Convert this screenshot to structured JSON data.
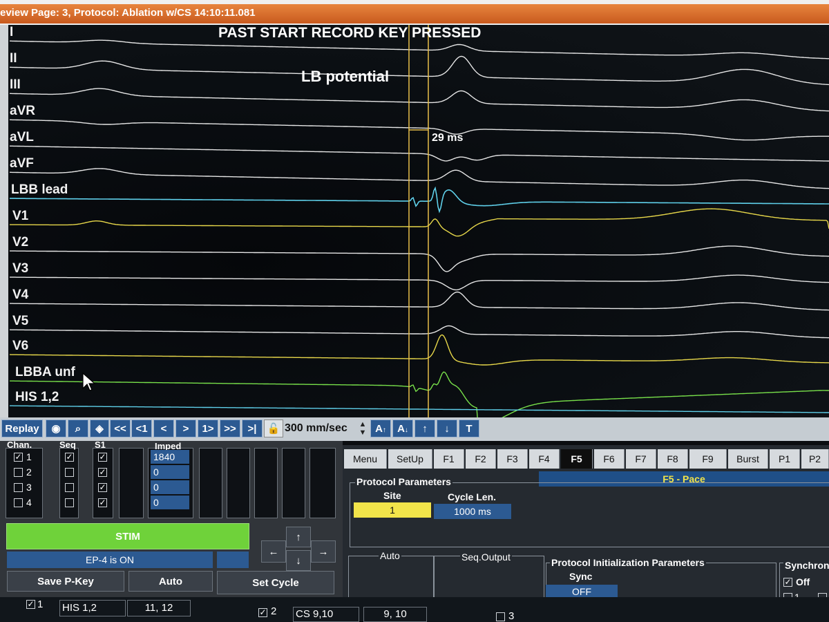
{
  "title": "eview Page: 3, Protocol: Ablation w/CS   14:10:11.081",
  "banners": {
    "main": "PAST START RECORD KEY PRESSED",
    "sub": "LB potential",
    "interval": "29 ms"
  },
  "leads": [
    {
      "label": "I",
      "color": "#e6e6e6"
    },
    {
      "label": "II",
      "color": "#e6e6e6"
    },
    {
      "label": "III",
      "color": "#e6e6e6"
    },
    {
      "label": "aVR",
      "color": "#e6e6e6"
    },
    {
      "label": "aVL",
      "color": "#e6e6e6"
    },
    {
      "label": "aVF",
      "color": "#e6e6e6"
    },
    {
      "label": "LBB lead",
      "color": "#5fd0ea"
    },
    {
      "label": "V1",
      "color": "#e8d84a"
    },
    {
      "label": "V2",
      "color": "#e6e6e6"
    },
    {
      "label": "V3",
      "color": "#e6e6e6"
    },
    {
      "label": "V4",
      "color": "#e6e6e6"
    },
    {
      "label": "V5",
      "color": "#e6e6e6"
    },
    {
      "label": "V6",
      "color": "#e8d84a"
    },
    {
      "label": "LBBA unf",
      "color": "#78e04a"
    },
    {
      "label": "HIS 1,2",
      "color": "#5fd0ea"
    }
  ],
  "toolbar": {
    "replay": "Replay",
    "first": "<<",
    "prev1": "<1",
    "prev": "<",
    "next": ">",
    "next1": "1>",
    "last": ">>",
    "end": ">|",
    "speed": "300 mm/sec",
    "amp_up": "A",
    "amp_down": "A",
    "up": "↑",
    "down": "↓",
    "t": "T"
  },
  "stim_panel": {
    "chan_header": "Chan.",
    "seq_header": "Seq",
    "s1_header": "S1",
    "imped_header": "Imped",
    "channels": [
      {
        "num": "1",
        "checked": true
      },
      {
        "num": "2",
        "checked": false
      },
      {
        "num": "3",
        "checked": false
      },
      {
        "num": "4",
        "checked": false
      }
    ],
    "seq_checked": [
      true,
      false,
      false,
      false
    ],
    "s1_checked": [
      true,
      true,
      true,
      true
    ],
    "imped_values": [
      "1840",
      "0",
      "0",
      "0"
    ],
    "stim_label": "STIM",
    "stim_color": "#6fd23a",
    "status": "EP-4 is ON",
    "save_pkey": "Save P-Key",
    "auto": "Auto",
    "set_cycle": "Set Cycle"
  },
  "tabs": [
    "Menu",
    "SetUp",
    "F1",
    "F2",
    "F3",
    "F4",
    "F5",
    "F6",
    "F7",
    "F8",
    "F9",
    "Burst",
    "P1",
    "P2"
  ],
  "active_tab": "F5",
  "pace": {
    "heading": "F5  - Pace",
    "heading_color": "#f2e44a",
    "protocol_parameters": "Protocol Parameters",
    "site_label": "Site",
    "site_value": "1",
    "site_color": "#f2e44a",
    "cycle_label": "Cycle Len.",
    "cycle_value": "1000 ms",
    "auto_label": "Auto",
    "seq_output_label": "Seq.Output",
    "init_params_label": "Protocol Initialization Parameters",
    "sync_label": "Sync",
    "sync_value": "OFF",
    "synchron_label": "Synchron",
    "off_label": "Off",
    "one_label": "1"
  },
  "bottom": {
    "ch1_num": "1",
    "ch1_name": "HIS 1,2",
    "ch1_pins": "11, 12",
    "ch2_num": "2",
    "ch2_name": "CS 9,10",
    "ch2_pins": "9, 10",
    "ch3_num": "3"
  }
}
